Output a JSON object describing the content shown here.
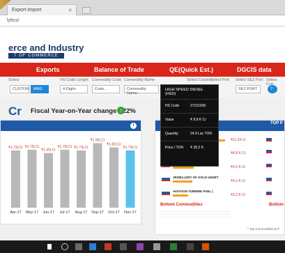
{
  "browser": {
    "tab_title": "Export-Import",
    "url": "lytics/"
  },
  "header": {
    "line1": "erce and Industry",
    "line2": "T OF COMMERCE"
  },
  "nav": [
    "Exports",
    "Balance of Trade",
    "QE(Quick Est.)",
    "DGCIS data"
  ],
  "filters": [
    {
      "label": "Select",
      "value": "CUSTOM"
    },
    {
      "label": "",
      "value": "MRG"
    },
    {
      "label": "HS Code Length",
      "value": "4-Digits"
    },
    {
      "label": "Commodity Code",
      "value": "Code..."
    },
    {
      "label": "Commodity Name",
      "value": "Commodity Name..."
    },
    {
      "label": "Select Country",
      "value": ""
    },
    {
      "label": "Select Port",
      "value": ""
    },
    {
      "label": "Select SEZ Port",
      "value": "SEZ PORT"
    },
    {
      "label": "Select Curr",
      "value": "?"
    }
  ],
  "summary": {
    "big": "Cr",
    "fy_title": "Fiscal Year-on-Year change : 22%"
  },
  "chart_data": {
    "type": "bar",
    "categories": [
      "Apr-17",
      "May-17",
      "Jun-17",
      "Jul-17",
      "Aug-17",
      "Sep-17",
      "Oct-17",
      "Nov-17"
    ],
    "values": [
      1.73,
      1.75,
      1.65,
      1.75,
      1.73,
      1.95,
      1.82,
      1.73
    ],
    "value_labels": [
      "₹1.73LCr",
      "₹1.75LCr",
      "₹1.65LCr",
      "₹1.75LCr",
      "₹1.73LCr",
      "₹1.95LCr",
      "₹1.82LCr",
      "₹1.73LCr"
    ],
    "highlight": "Nov-17",
    "colors": {
      "default": "#b8b8b8",
      "highlight": "#5bc0eb"
    }
  },
  "tooltip": {
    "title": "HIGH SPEED DIESEL (HSD)",
    "rows": [
      {
        "k": "HS Code",
        "v": "27101930"
      },
      {
        "k": "Value",
        "v": "₹ 8.8 K Cr"
      },
      {
        "k": "Quantity",
        "v": "24.9 Lac TON"
      },
      {
        "k": "Price / TON",
        "v": "₹ 35.2 K"
      }
    ]
  },
  "right_panel": {
    "title": "TOP P",
    "commodities": [
      {
        "name": "",
        "value": "₹11.24 Cr"
      },
      {
        "name": "HIGH SPEED DIESEL (HSD)",
        "value": "₹8.8 K Cr"
      },
      {
        "name": "OTHER",
        "value": "₹4.2 K Cr"
      },
      {
        "name": "JEWELLERY OF GOLD UNSET",
        "value": "₹4.2 K Cr"
      },
      {
        "name": "AVIATION TURBINE FUEL (",
        "value": "₹3.2 K Cr"
      }
    ],
    "bottom_title": "Bottom Commodities",
    "bottom_label": "Bottom",
    "footnote": "* Top Commodities & P"
  },
  "colors": {
    "brand_red": "#d8261b",
    "brand_blue": "#1f5aa8",
    "accent": "#1e88d4"
  }
}
